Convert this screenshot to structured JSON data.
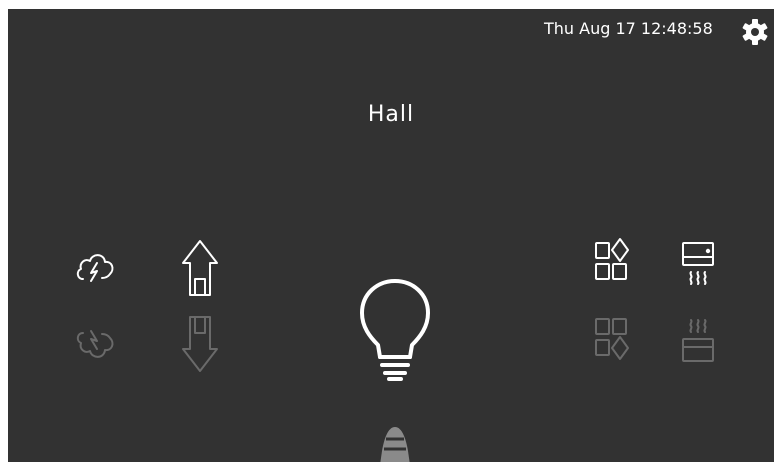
{
  "header": {
    "datetime": "Thu Aug 17  12:48:58"
  },
  "room": {
    "title": "Hall"
  },
  "icons": {
    "left": [
      "weather-icon",
      "home-icon"
    ],
    "left_reflection": [
      "weather-icon-reflection",
      "home-icon-reflection"
    ],
    "center": "light-bulb-icon",
    "right": [
      "scenes-icon",
      "heating-icon"
    ],
    "right_reflection": [
      "scenes-icon-reflection",
      "heating-icon-reflection"
    ],
    "settings": "gear-icon"
  },
  "colors": {
    "screen_background": "#323232",
    "foreground": "#ffffff",
    "reflection": "#6a6a6a"
  }
}
